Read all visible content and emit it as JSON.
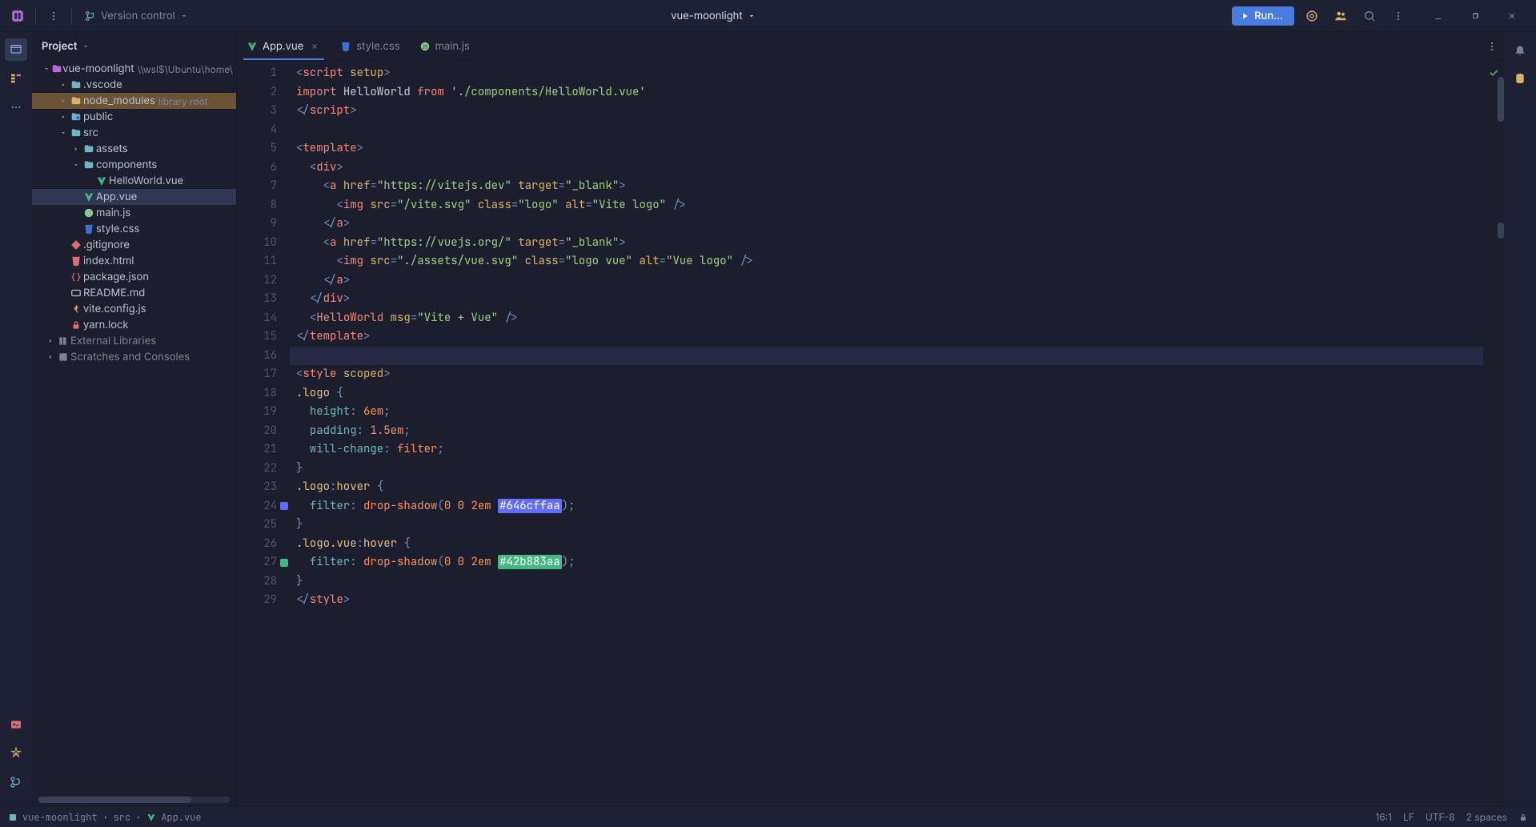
{
  "titlebar": {
    "version_control_label": "Version control",
    "project_name": "vue-moonlight",
    "run_label": "Run..."
  },
  "tree_panel": {
    "header": "Project"
  },
  "project_tree": {
    "root": {
      "label": "vue-moonlight",
      "suffix": "\\\\wsl$\\Ubuntu\\home\\"
    },
    "vscode": ".vscode",
    "node_modules": {
      "label": "node_modules",
      "suffix": "library root"
    },
    "public": "public",
    "src": "src",
    "assets": "assets",
    "components": "components",
    "hello_world": "HelloWorld.vue",
    "app_vue": "App.vue",
    "main_js": "main.js",
    "style_css": "style.css",
    "gitignore": ".gitignore",
    "index_html": "index.html",
    "package_json": "package.json",
    "readme": "README.md",
    "vite_config": "vite.config.js",
    "yarn_lock": "yarn.lock",
    "external_libraries": "External Libraries",
    "scratches": "Scratches and Consoles"
  },
  "tabs": {
    "app_vue": "App.vue",
    "style_css": "style.css",
    "main_js": "main.js"
  },
  "editor": {
    "active_file": "App.vue",
    "current_line": 16,
    "colors": {
      "c1": "#646cffaa",
      "c2": "#42b883aa"
    }
  },
  "code_lines": [
    {
      "n": 1,
      "html": "<span class='tk-punc'>&lt;</span><span class='tk-tag'>script</span> <span class='tk-attr'>setup</span><span class='tk-punc'>&gt;</span>"
    },
    {
      "n": 2,
      "html": "<span class='tk-kw'>import</span> <span class='tk-id'>HelloWorld</span> <span class='tk-kw'>from</span> <span class='tk-str'>'./components/HelloWorld.vue'</span>"
    },
    {
      "n": 3,
      "html": "<span class='tk-punc'>&lt;/</span><span class='tk-tag'>script</span><span class='tk-punc'>&gt;</span>"
    },
    {
      "n": 4,
      "html": ""
    },
    {
      "n": 5,
      "html": "<span class='tk-punc'>&lt;</span><span class='tk-tag'>template</span><span class='tk-punc'>&gt;</span>"
    },
    {
      "n": 6,
      "html": "  <span class='tk-punc'>&lt;</span><span class='tk-tag'>div</span><span class='tk-punc'>&gt;</span>"
    },
    {
      "n": 7,
      "html": "    <span class='tk-punc'>&lt;</span><span class='tk-tag'>a</span> <span class='tk-attr'>href</span><span class='tk-punc'>=</span><span class='tk-str'>\"https://vitejs.dev\"</span> <span class='tk-attr'>target</span><span class='tk-punc'>=</span><span class='tk-str'>\"_blank\"</span><span class='tk-punc'>&gt;</span>"
    },
    {
      "n": 8,
      "html": "      <span class='tk-punc'>&lt;</span><span class='tk-tag'>img</span> <span class='tk-attr'>src</span><span class='tk-punc'>=</span><span class='tk-str'>\"/vite.svg\"</span> <span class='tk-attr'>class</span><span class='tk-punc'>=</span><span class='tk-str'>\"logo\"</span> <span class='tk-attr'>alt</span><span class='tk-punc'>=</span><span class='tk-str'>\"Vite logo\"</span> <span class='tk-punc'>/&gt;</span>"
    },
    {
      "n": 9,
      "html": "    <span class='tk-punc'>&lt;/</span><span class='tk-tag'>a</span><span class='tk-punc'>&gt;</span>"
    },
    {
      "n": 10,
      "html": "    <span class='tk-punc'>&lt;</span><span class='tk-tag'>a</span> <span class='tk-attr'>href</span><span class='tk-punc'>=</span><span class='tk-str'>\"https://vuejs.org/\"</span> <span class='tk-attr'>target</span><span class='tk-punc'>=</span><span class='tk-str'>\"_blank\"</span><span class='tk-punc'>&gt;</span>"
    },
    {
      "n": 11,
      "html": "      <span class='tk-punc'>&lt;</span><span class='tk-tag'>img</span> <span class='tk-attr'>src</span><span class='tk-punc'>=</span><span class='tk-str'>\"./assets/vue.svg\"</span> <span class='tk-attr'>class</span><span class='tk-punc'>=</span><span class='tk-str'>\"logo vue\"</span> <span class='tk-attr'>alt</span><span class='tk-punc'>=</span><span class='tk-str'>\"Vue logo\"</span> <span class='tk-punc'>/&gt;</span>"
    },
    {
      "n": 12,
      "html": "    <span class='tk-punc'>&lt;/</span><span class='tk-tag'>a</span><span class='tk-punc'>&gt;</span>"
    },
    {
      "n": 13,
      "html": "  <span class='tk-punc'>&lt;/</span><span class='tk-tag'>div</span><span class='tk-punc'>&gt;</span>"
    },
    {
      "n": 14,
      "html": "  <span class='tk-punc'>&lt;</span><span class='tk-tag'>HelloWorld</span> <span class='tk-attr'>msg</span><span class='tk-punc'>=</span><span class='tk-str'>\"Vite + Vue\"</span> <span class='tk-punc'>/&gt;</span>"
    },
    {
      "n": 15,
      "html": "<span class='tk-punc'>&lt;/</span><span class='tk-tag'>template</span><span class='tk-punc'>&gt;</span>"
    },
    {
      "n": 16,
      "html": "",
      "current": true
    },
    {
      "n": 17,
      "html": "<span class='tk-punc'>&lt;</span><span class='tk-tag'>style</span> <span class='tk-attr'>scoped</span><span class='tk-punc'>&gt;</span>"
    },
    {
      "n": 18,
      "html": "<span class='tk-css-sel'>.logo</span> <span class='tk-punc'>{</span>"
    },
    {
      "n": 19,
      "html": "  <span class='tk-css-prop'>height</span><span class='tk-punc'>:</span> <span class='tk-css-num'>6em</span><span class='tk-punc'>;</span>"
    },
    {
      "n": 20,
      "html": "  <span class='tk-css-prop'>padding</span><span class='tk-punc'>:</span> <span class='tk-css-num'>1.5em</span><span class='tk-punc'>;</span>"
    },
    {
      "n": 21,
      "html": "  <span class='tk-css-prop'>will-change</span><span class='tk-punc'>:</span> <span class='tk-css-val'>filter</span><span class='tk-punc'>;</span>"
    },
    {
      "n": 22,
      "html": "<span class='tk-punc'>}</span>"
    },
    {
      "n": 23,
      "html": "<span class='tk-css-sel'>.logo</span><span class='tk-punc'>:</span><span class='tk-css-sel'>hover</span> <span class='tk-punc'>{</span>"
    },
    {
      "n": 24,
      "html": "  <span class='tk-css-prop'>filter</span><span class='tk-punc'>:</span> <span class='tk-css-val'>drop-shadow</span><span class='tk-punc'>(</span><span class='tk-css-num'>0 0 2em</span> <span class='colbox c1'>#646cffaa</span><span class='tk-punc'>);</span>",
      "swatch": "#646cff"
    },
    {
      "n": 25,
      "html": "<span class='tk-punc'>}</span>"
    },
    {
      "n": 26,
      "html": "<span class='tk-css-sel'>.logo.vue</span><span class='tk-punc'>:</span><span class='tk-css-sel'>hover</span> <span class='tk-punc'>{</span>"
    },
    {
      "n": 27,
      "html": "  <span class='tk-css-prop'>filter</span><span class='tk-punc'>:</span> <span class='tk-css-val'>drop-shadow</span><span class='tk-punc'>(</span><span class='tk-css-num'>0 0 2em</span> <span class='colbox c2'>#42b883aa</span><span class='tk-punc'>);</span>",
      "swatch": "#42b883"
    },
    {
      "n": 28,
      "html": "<span class='tk-punc'>}</span>"
    },
    {
      "n": 29,
      "html": "<span class='tk-punc'>&lt;/</span><span class='tk-tag'>style</span><span class='tk-punc'>&gt;</span>"
    }
  ],
  "statusbar": {
    "crumbs": [
      "vue-moonlight",
      "src",
      "App.vue"
    ],
    "pos": "16:1",
    "eol": "LF",
    "encoding": "UTF-8",
    "indent": "2 spaces"
  }
}
